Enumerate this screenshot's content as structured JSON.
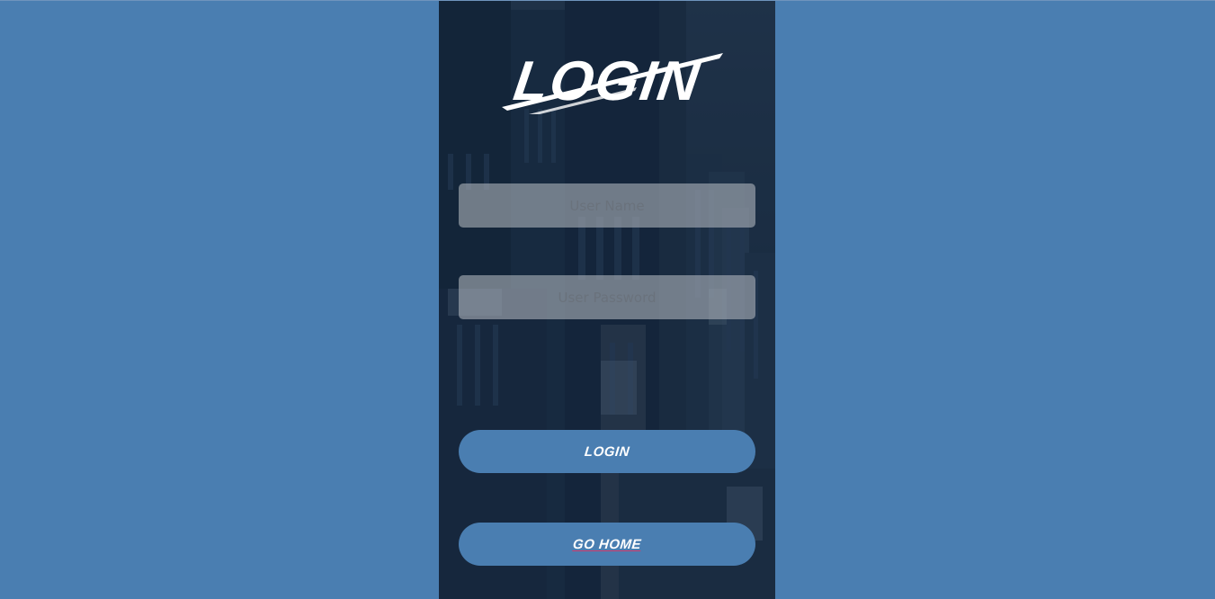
{
  "colors": {
    "page_background": "#4a7eb1",
    "panel_overlay": "#162538",
    "button": "#4a7eb1",
    "title": "#ffffff"
  },
  "login_panel": {
    "title": "LOGIN",
    "username": {
      "placeholder": "User Name",
      "value": ""
    },
    "password": {
      "placeholder": "User Password",
      "value": ""
    },
    "login_button": "LOGIN",
    "home_button": "GO HOME"
  }
}
